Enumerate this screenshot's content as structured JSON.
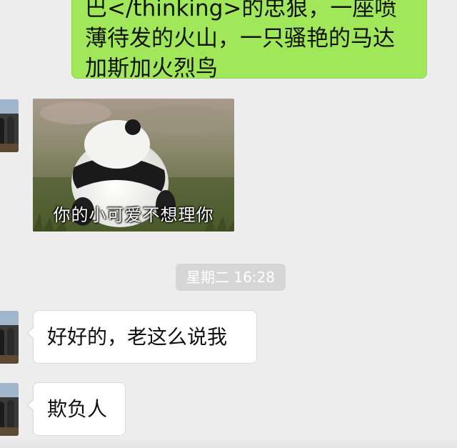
{
  "messages": {
    "outgoing_text": "巴</thinking>的忠狠，一座喷薄待发的火山，一只骚艳的马达加斯加火烈鸟",
    "sticker_caption": "你的小可爱不想理你",
    "timestamp": "星期二 16:28",
    "incoming_1": "好好的，老这么说我",
    "incoming_2": "欺负人"
  },
  "colors": {
    "background": "#ededed",
    "outgoing_bubble": "#a0e75a",
    "incoming_bubble": "#ffffff",
    "timestamp_pill": "#d6d6d6"
  }
}
